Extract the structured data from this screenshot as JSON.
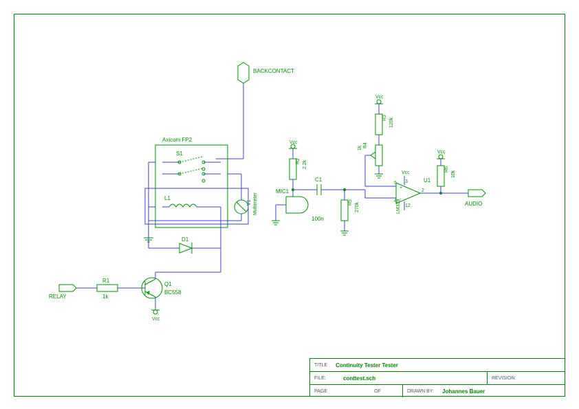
{
  "labels": {
    "backcontact": "BACKCONTACT",
    "relay": "RELAY",
    "audio": "AUDIO",
    "axicom": "Axicom FP2",
    "s1": "S1",
    "l1": "L1",
    "d1": "D1",
    "v1": "V1",
    "multimeter": "Multimeter",
    "r1": "R1",
    "r1v": "1k",
    "q1": "Q1",
    "q1v": "BC558",
    "r2": "R2",
    "r2v": "2.2k",
    "mic1": "MIC1",
    "c1": "C1",
    "c1v": "100n",
    "r3": "R3",
    "r3v": "120k",
    "r4": "R4",
    "r4v": "1k",
    "r5": "R5",
    "r5v": "270k",
    "u1": "U1",
    "u1v": "LM339",
    "u1p3": "3",
    "u1p4": "4",
    "u1p5": "5",
    "u1p12": "12",
    "u1p2": "2",
    "r6": "R6",
    "r6v": "10k",
    "vcc": "Vcc"
  },
  "titleblock": {
    "title_lbl": "TITLE",
    "title": "Continuity Tester Tester",
    "file_lbl": "FILE:",
    "file": "conttest.sch",
    "rev_lbl": "REVISION:",
    "page_lbl": "PAGE",
    "of_lbl": "OF",
    "drawn_lbl": "DRAWN BY:",
    "drawn": "Johannes Bauer"
  },
  "chart_data": {
    "type": "diagram",
    "title": "Continuity Tester Tester",
    "description": "Electronic schematic",
    "components": [
      {
        "ref": "S1",
        "name": "Axicom FP2",
        "type": "relay-switch"
      },
      {
        "ref": "L1",
        "type": "inductor/coil"
      },
      {
        "ref": "V1",
        "name": "Multimeter",
        "type": "measurement"
      },
      {
        "ref": "D1",
        "type": "diode"
      },
      {
        "ref": "R1",
        "type": "resistor",
        "value": "1k"
      },
      {
        "ref": "Q1",
        "type": "transistor",
        "value": "BC558"
      },
      {
        "ref": "R2",
        "type": "resistor",
        "value": "2.2k"
      },
      {
        "ref": "MIC1",
        "type": "microphone"
      },
      {
        "ref": "C1",
        "type": "capacitor",
        "value": "100n"
      },
      {
        "ref": "R3",
        "type": "resistor",
        "value": "120k"
      },
      {
        "ref": "R4",
        "type": "potentiometer",
        "value": "1k"
      },
      {
        "ref": "R5",
        "type": "resistor",
        "value": "270k"
      },
      {
        "ref": "U1",
        "type": "comparator",
        "value": "LM339"
      },
      {
        "ref": "R6",
        "type": "resistor",
        "value": "10k"
      }
    ],
    "ports": [
      "BACKCONTACT",
      "RELAY",
      "AUDIO"
    ],
    "power": [
      "Vcc",
      "GND"
    ]
  }
}
